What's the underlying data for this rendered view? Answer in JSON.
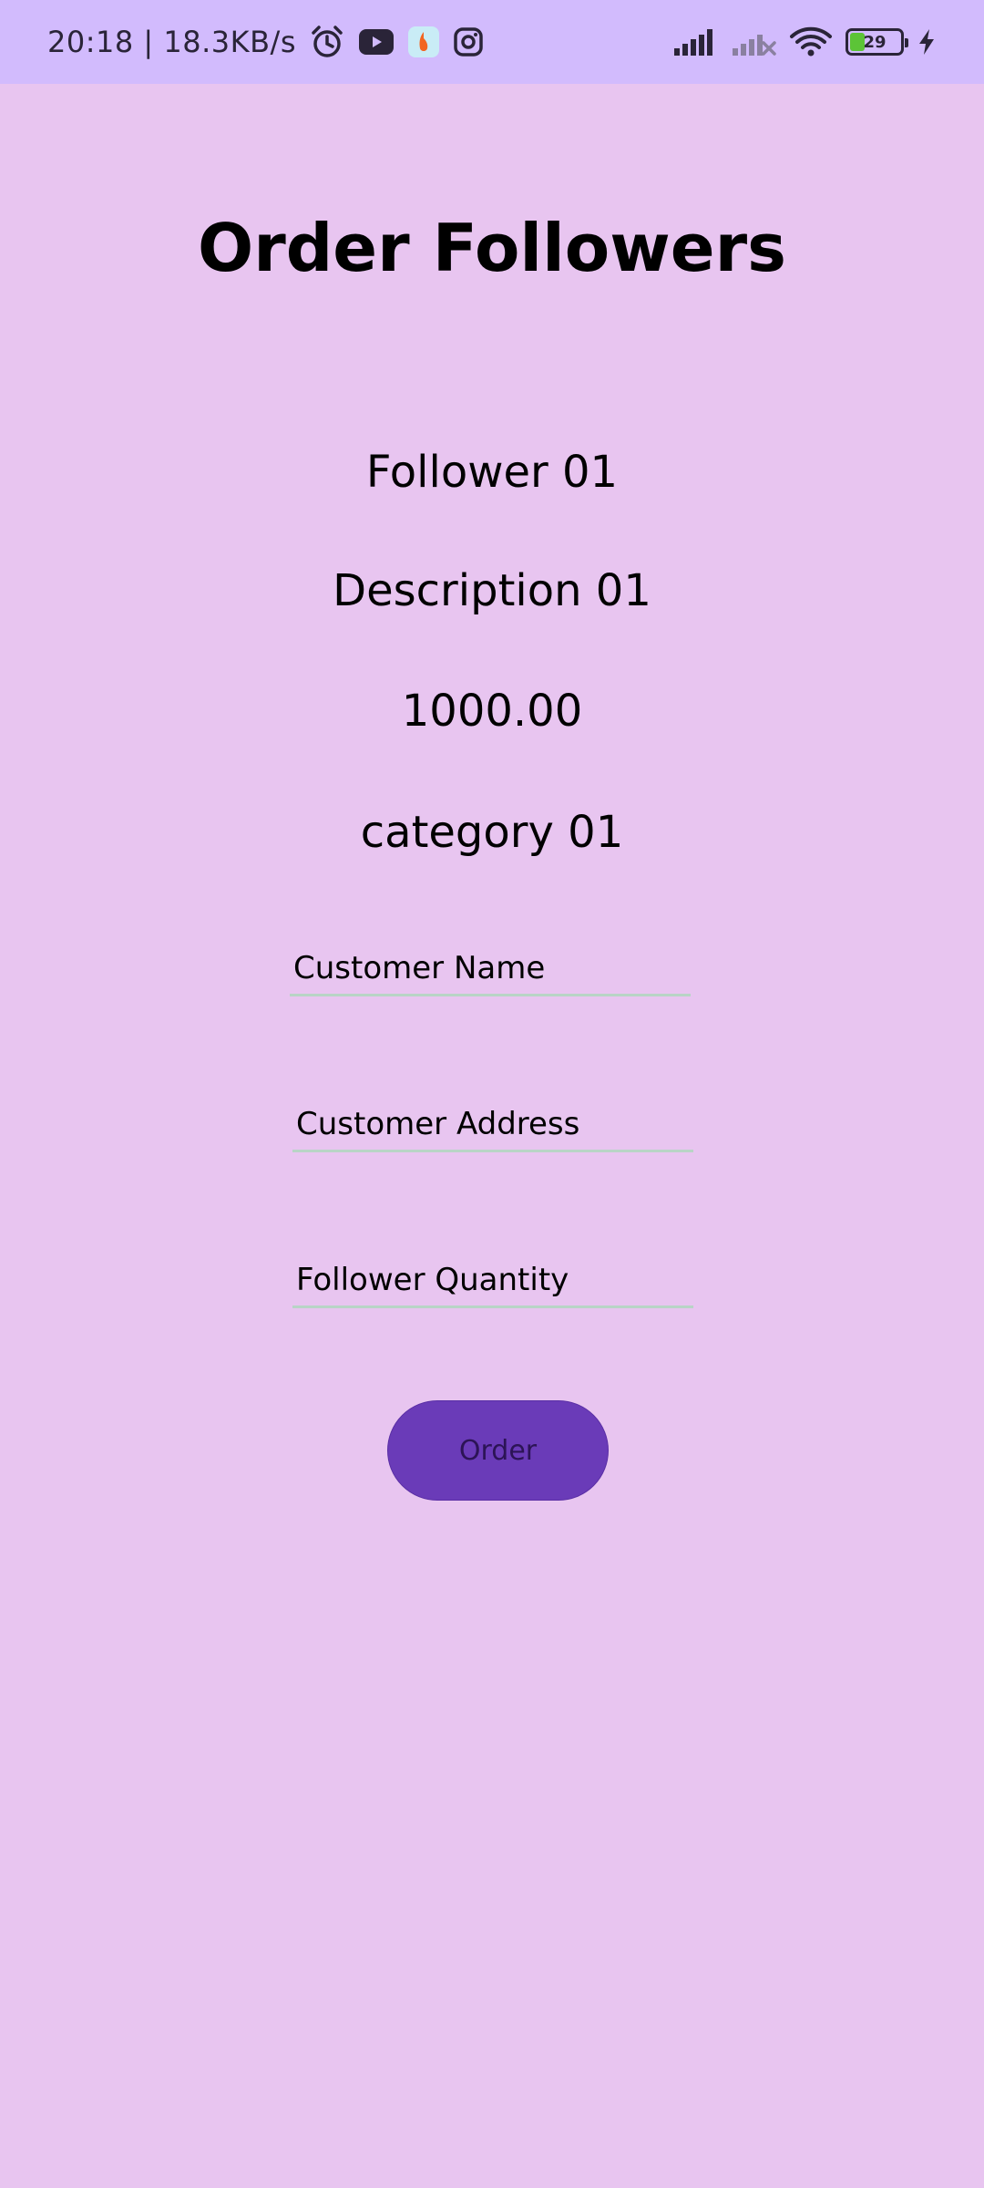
{
  "status_bar": {
    "time": "20:18",
    "separator": "|",
    "network_speed": "18.3KB/s",
    "battery_level": "29",
    "battery_fraction": 0.29,
    "icons": [
      "alarm-icon",
      "youtube-icon",
      "app-icon",
      "instagram-icon",
      "signal-icon",
      "signal-no-service-icon",
      "wifi-icon",
      "battery-icon",
      "charging-icon"
    ]
  },
  "page": {
    "title": "Order Followers"
  },
  "product": {
    "name": "Follower 01",
    "description": "Description 01",
    "price": "1000.00",
    "category": "category 01"
  },
  "form": {
    "customer_name_placeholder": "Customer Name",
    "customer_address_placeholder": "Customer Address",
    "follower_quantity_placeholder": "Follower Quantity",
    "order_button_label": "Order"
  },
  "colors": {
    "background": "#e8c5f0",
    "status_bar": "#d2bbfd",
    "button": "#6a3bb8",
    "field_underline": "#b8d4c6"
  }
}
